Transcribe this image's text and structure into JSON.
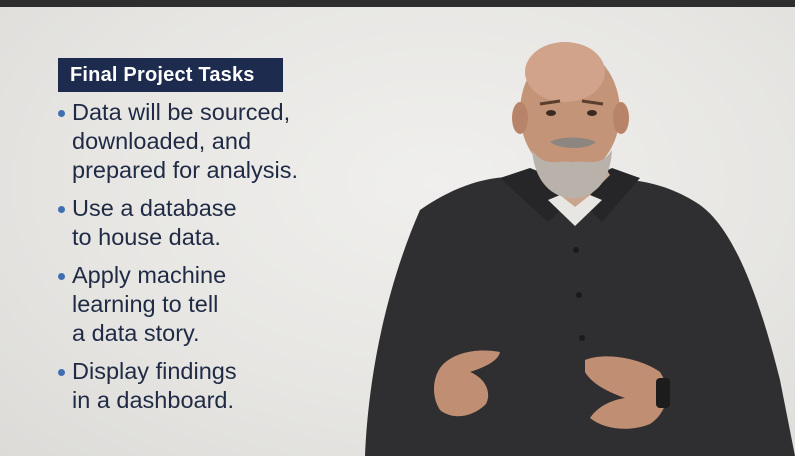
{
  "slide": {
    "title": "Final Project Tasks",
    "bullets": [
      {
        "text": "Data will be sourced,\ndownloaded, and\nprepared for analysis."
      },
      {
        "text": "Use a database\nto house data."
      },
      {
        "text": "Apply machine\nlearning to tell\na data story."
      },
      {
        "text": "Display findings\nin a dashboard."
      }
    ]
  },
  "colors": {
    "title_background": "#1c2b4e",
    "bullet_text": "#1f2a44",
    "bullet_dot": "#3f6fb0",
    "background": "#e7e6e3",
    "shirt": "#2f2f31"
  }
}
